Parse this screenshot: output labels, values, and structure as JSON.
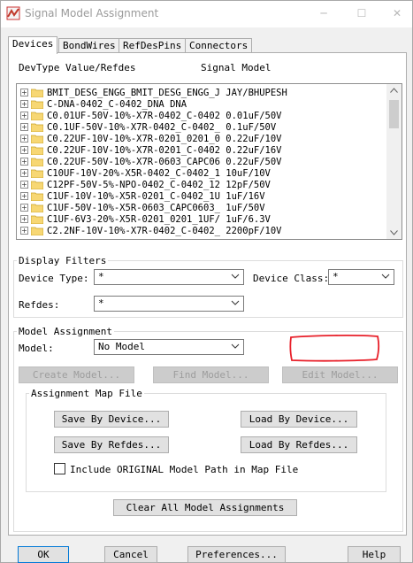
{
  "window": {
    "title": "Signal Model Assignment",
    "minimize": "─",
    "maximize": "☐",
    "close": "✕"
  },
  "tabs": [
    {
      "label": "Devices"
    },
    {
      "label": "BondWires"
    },
    {
      "label": "RefDesPins"
    },
    {
      "label": "Connectors"
    }
  ],
  "list": {
    "header_devtype": "DevType Value/Refdes",
    "header_model": "Signal Model",
    "rows": [
      "BMIT_DESG_ENGG_BMIT_DESG_ENGG_J JAY/BHUPESH",
      "C-DNA-0402_C-0402_DNA DNA",
      "C0.01UF-50V-10%-X7R-0402_C-0402 0.01uF/50V",
      "C0.1UF-50V-10%-X7R-0402_C-0402_ 0.1uF/50V",
      "C0.22UF-10V-10%-X7R-0201_0201_0 0.22uF/10V",
      "C0.22UF-10V-10%-X7R-0201_C-0402 0.22uF/16V",
      "C0.22UF-50V-10%-X7R-0603_CAPC06 0.22uF/50V",
      "C10UF-10V-20%-X5R-0402_C-0402_1 10uF/10V",
      "C12PF-50V-5%-NPO-0402_C-0402_12 12pF/50V",
      "C1UF-10V-10%-X5R-0201_C-0402_1U 1uF/16V",
      "C1UF-50V-10%-X5R-0603_CAPC0603_ 1uF/50V",
      "C1UF-6V3-20%-X5R-0201_0201_1UF/ 1uF/6.3V",
      "C2.2NF-10V-10%-X7R-0402_C-0402_ 2200pF/10V"
    ]
  },
  "display_filters": {
    "title": "Display Filters",
    "device_type_label": "Device Type:",
    "device_type_value": "*",
    "device_class_label": "Device Class:",
    "device_class_value": "*",
    "refdes_label": "Refdes:",
    "refdes_value": "*"
  },
  "model_assignment": {
    "title": "Model Assignment",
    "model_label": "Model:",
    "model_value": "No Model",
    "create_model": "Create Model...",
    "find_model": "Find Model...",
    "edit_model": "Edit Model..."
  },
  "assignment_map": {
    "title": "Assignment Map File",
    "save_by_device": "Save By Device...",
    "load_by_device": "Load By Device...",
    "save_by_refdes": "Save By Refdes...",
    "load_by_refdes": "Load By Refdes...",
    "include_original": "Include ORIGINAL Model Path in Map File",
    "include_original_checked": false
  },
  "clear_all": "Clear All Model Assignments",
  "footer": {
    "ok": "OK",
    "cancel": "Cancel",
    "preferences": "Preferences...",
    "help": "Help"
  },
  "colors": {
    "annotation_red": "#e8202a",
    "folder": "#f7d774",
    "default_border": "#0078d7"
  }
}
